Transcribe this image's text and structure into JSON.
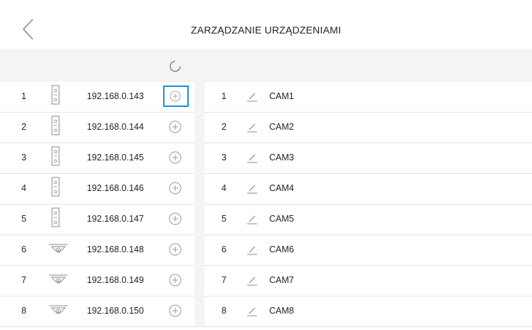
{
  "header": {
    "title": "ZARZĄDZANIE URZĄDZENIAMI"
  },
  "devices": [
    {
      "index": "1",
      "type": "door-station",
      "ip": "192.168.0.143",
      "selected": true
    },
    {
      "index": "2",
      "type": "door-station",
      "ip": "192.168.0.144",
      "selected": false
    },
    {
      "index": "3",
      "type": "door-station",
      "ip": "192.168.0.145",
      "selected": false
    },
    {
      "index": "4",
      "type": "door-station",
      "ip": "192.168.0.146",
      "selected": false
    },
    {
      "index": "5",
      "type": "door-station",
      "ip": "192.168.0.147",
      "selected": false
    },
    {
      "index": "6",
      "type": "dome-camera",
      "ip": "192.168.0.148",
      "selected": false
    },
    {
      "index": "7",
      "type": "dome-camera",
      "ip": "192.168.0.149",
      "selected": false
    },
    {
      "index": "8",
      "type": "dome-camera",
      "ip": "192.168.0.150",
      "selected": false
    }
  ],
  "cameras": [
    {
      "index": "1",
      "name": "CAM1"
    },
    {
      "index": "2",
      "name": "CAM2"
    },
    {
      "index": "3",
      "name": "CAM3"
    },
    {
      "index": "4",
      "name": "CAM4"
    },
    {
      "index": "5",
      "name": "CAM5"
    },
    {
      "index": "6",
      "name": "CAM6"
    },
    {
      "index": "7",
      "name": "CAM7"
    },
    {
      "index": "8",
      "name": "CAM8"
    }
  ],
  "colors": {
    "accent": "#1a8fd8",
    "toolbar_bg": "#f4f4f6"
  },
  "icons": {
    "back": "chevron-left-icon",
    "refresh": "refresh-icon",
    "add": "plus-circle-icon",
    "edit": "pencil-icon"
  }
}
